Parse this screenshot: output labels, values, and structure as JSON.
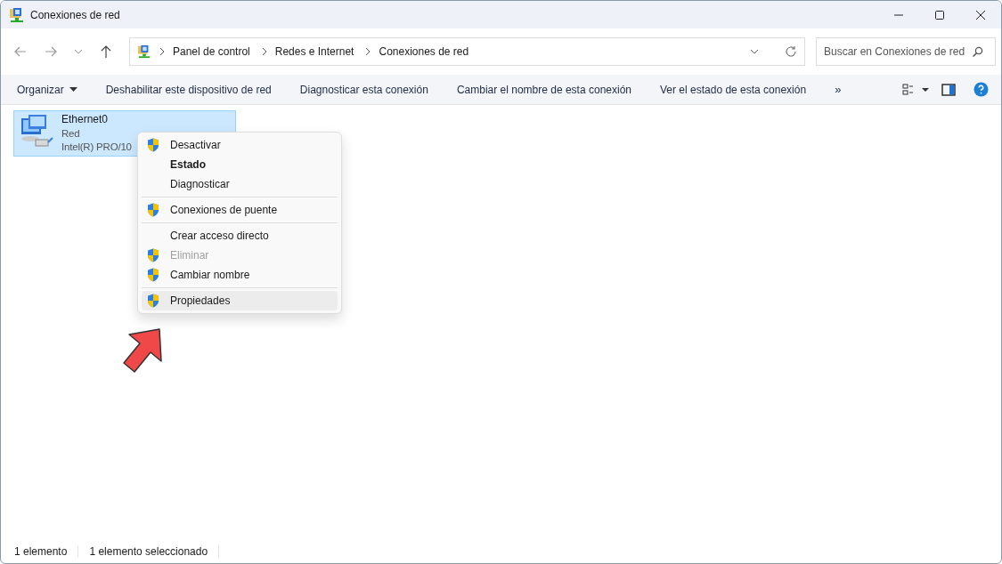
{
  "window": {
    "title": "Conexiones de red"
  },
  "address": {
    "crumbs": [
      "Panel de control",
      "Redes e Internet",
      "Conexiones de red"
    ]
  },
  "search": {
    "placeholder": "Buscar en Conexiones de red"
  },
  "toolbar": {
    "organize": "Organizar",
    "commands": [
      "Deshabilitar este dispositivo de red",
      "Diagnosticar esta conexión",
      "Cambiar el nombre de esta conexión",
      "Ver el estado de esta conexión"
    ],
    "more": "»"
  },
  "items": [
    {
      "name": "Ethernet0",
      "status": "Red",
      "adapter": "Intel(R) PRO/10",
      "selected": true
    }
  ],
  "context_menu": [
    {
      "kind": "item",
      "label": "Desactivar",
      "shield": true,
      "bold": false,
      "disabled": false,
      "selected": false
    },
    {
      "kind": "item",
      "label": "Estado",
      "shield": false,
      "bold": true,
      "disabled": false,
      "selected": false
    },
    {
      "kind": "item",
      "label": "Diagnosticar",
      "shield": false,
      "bold": false,
      "disabled": false,
      "selected": false
    },
    {
      "kind": "separator"
    },
    {
      "kind": "item",
      "label": "Conexiones de puente",
      "shield": true,
      "bold": false,
      "disabled": false,
      "selected": false
    },
    {
      "kind": "separator"
    },
    {
      "kind": "item",
      "label": "Crear acceso directo",
      "shield": false,
      "bold": false,
      "disabled": false,
      "selected": false
    },
    {
      "kind": "item",
      "label": "Eliminar",
      "shield": true,
      "bold": false,
      "disabled": true,
      "selected": false
    },
    {
      "kind": "item",
      "label": "Cambiar nombre",
      "shield": true,
      "bold": false,
      "disabled": false,
      "selected": false
    },
    {
      "kind": "separator"
    },
    {
      "kind": "item",
      "label": "Propiedades",
      "shield": true,
      "bold": false,
      "disabled": false,
      "selected": true
    }
  ],
  "status_bar": [
    "1 elemento",
    "1 elemento seleccionado"
  ]
}
